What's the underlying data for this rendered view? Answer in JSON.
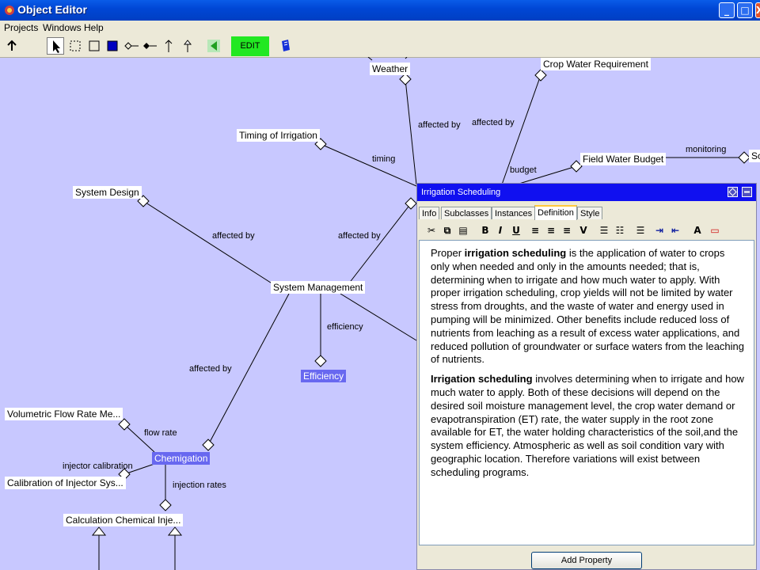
{
  "window": {
    "title": "Object Editor"
  },
  "menu": [
    "Projects",
    "Windows",
    "Help"
  ],
  "toolbar": {
    "edit_label": "EDIT"
  },
  "nodes": {
    "weather": "Weather",
    "crop_water": "Crop Water Requirement",
    "timing": "Timing of Irrigation",
    "field_budget": "Field Water Budget",
    "system_design": "System Design",
    "system_management": "System Management",
    "efficiency": "Efficiency",
    "volumetric": "Volumetric Flow Rate Me...",
    "chemigation": "Chemigation",
    "calibration": "Calibration of Injector Sys...",
    "calc_chem": "Calculation Chemical Inje...",
    "right_partial": "Sc"
  },
  "edge_labels": {
    "affected_by_1": "affected by",
    "affected_by_2": "affected by",
    "timing": "timing",
    "budget": "budget",
    "monitoring": "monitoring",
    "affected_by_3": "affected by",
    "affected_by_4": "affected by",
    "efficiency": "efficiency",
    "affected_by_5": "affected by",
    "flow_rate": "flow rate",
    "injector_calibration": "injector calibration",
    "injection_rates": "injection rates"
  },
  "panel": {
    "title": "Irrigation Scheduling",
    "tabs": [
      "Info",
      "Subclasses",
      "Instances",
      "Definition",
      "Style"
    ],
    "active_tab": "Definition",
    "p1_a": "Proper ",
    "p1_bold": "irrigation scheduling",
    "p1_b": " is the application of water to crops only when needed and only in the amounts needed; that is, determining when to irrigate and how much water to apply. With proper irrigation scheduling, crop yields will not be limited by water stress from droughts, and the waste of water and energy used in pumping will be minimized. Other benefits include reduced loss of nutrients from leaching as a result of excess water applications, and reduced pollution of groundwater or surface waters from the leaching of nutrients.",
    "p2_bold": "Irrigation scheduling",
    "p2_b": " involves determining when to irrigate and how much water to apply. Both of these decisions will depend on the desired soil moisture management level, the crop water demand or evapotranspiration (ET) rate, the water supply in the root zone available for ET, the water holding characteristics of the soil,and the system efficiency. Atmospheric as well as soil condition vary with geographic location. Therefore variations will exist between scheduling programs.",
    "add_property": "Add Property"
  },
  "colors": {
    "canvas": "#c8c8ff",
    "panel_header": "#1010f0",
    "edit_button": "#22e822",
    "highlight_node": "#6868f0"
  }
}
